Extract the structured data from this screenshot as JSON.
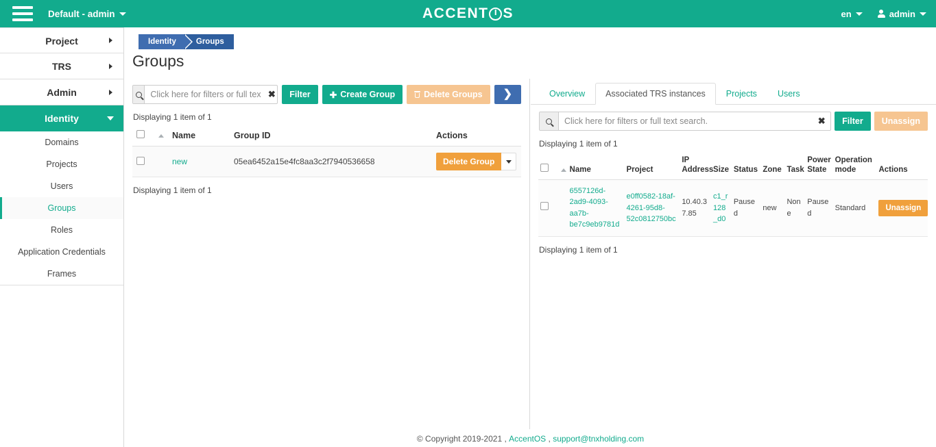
{
  "topbar": {
    "menu_icon": "hamburger-icon",
    "context_label": "Default - admin",
    "logo_part1": "ACCENT",
    "logo_part2": "S",
    "language": "en",
    "user": "admin"
  },
  "sidebar": {
    "top_items": [
      {
        "label": "Project",
        "active": false
      },
      {
        "label": "TRS",
        "active": false
      },
      {
        "label": "Admin",
        "active": false
      },
      {
        "label": "Identity",
        "active": true
      }
    ],
    "sub_items": [
      {
        "label": "Domains",
        "selected": false
      },
      {
        "label": "Projects",
        "selected": false
      },
      {
        "label": "Users",
        "selected": false
      },
      {
        "label": "Groups",
        "selected": true
      },
      {
        "label": "Roles",
        "selected": false
      },
      {
        "label": "Application Credentials",
        "selected": false
      },
      {
        "label": "Frames",
        "selected": false
      }
    ]
  },
  "breadcrumb": {
    "crumb1": "Identity",
    "crumb2": "Groups"
  },
  "page_title": "Groups",
  "left_panel": {
    "search_placeholder": "Click here for filters or full text search.",
    "search_value": "",
    "clear_icon": "clear-x-icon",
    "buttons": {
      "filter": "Filter",
      "create_group": "Create Group",
      "delete_groups": "Delete Groups",
      "next": "❯"
    },
    "count_top": "Displaying 1 item of 1",
    "count_bottom": "Displaying 1 item of 1",
    "columns": [
      "Name",
      "Group ID",
      "Actions"
    ],
    "rows": [
      {
        "name": "new",
        "group_id": "05ea6452a15e4fc8aa3c2f7940536658",
        "action_label": "Delete Group"
      }
    ]
  },
  "right_panel": {
    "tabs": [
      {
        "label": "Overview",
        "active": false
      },
      {
        "label": "Associated TRS instances",
        "active": true
      },
      {
        "label": "Projects",
        "active": false
      },
      {
        "label": "Users",
        "active": false
      }
    ],
    "search_placeholder": "Click here for filters or full text search.",
    "search_value": "",
    "buttons": {
      "filter": "Filter",
      "unassign": "Unassign"
    },
    "count_top": "Displaying 1 item of 1",
    "count_bottom": "Displaying 1 item of 1",
    "columns": [
      "Name",
      "Project",
      "IP Address",
      "Size",
      "Status",
      "Zone",
      "Task",
      "Power State",
      "Operation mode",
      "Actions"
    ],
    "rows": [
      {
        "name": "6557126d-2ad9-4093-aa7b-be7c9eb9781d",
        "project": "e0ff0582-18af-4261-95d8-52c0812750bc",
        "ip_address": "10.40.37.85",
        "size": "c1_r128_d0",
        "status": "Paused",
        "zone": "new",
        "task": "None",
        "power_state": "Paused",
        "operation_mode": "Standard",
        "action_label": "Unassign"
      }
    ]
  },
  "footer": {
    "copyright": "© Copyright 2019-2021 ,",
    "brand": "AccentOS",
    "separator": ",",
    "email": "support@tnxholding.com"
  },
  "colors": {
    "brand_green": "#12ab8d",
    "breadcrumb_blue": "#3f6db0",
    "breadcrumb_blue_dark": "#2e5e9e",
    "orange": "#f0a03c",
    "orange_pale": "#f6c591"
  }
}
